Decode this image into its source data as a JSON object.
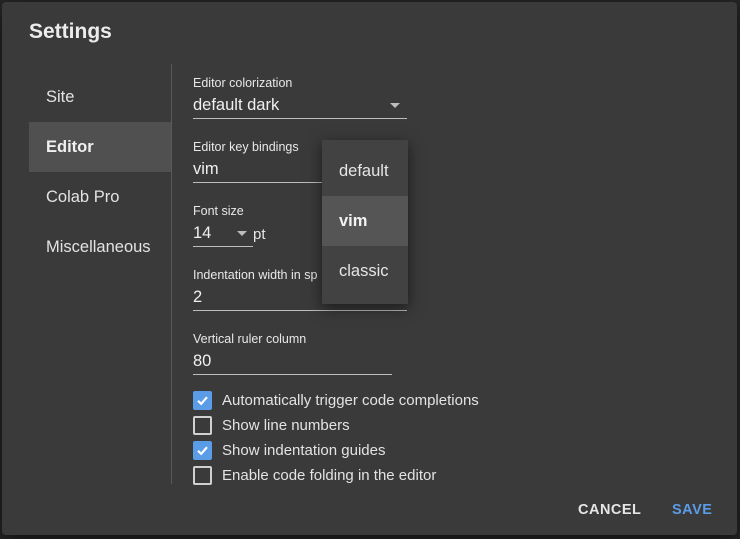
{
  "dialog": {
    "title": "Settings"
  },
  "sidebar": {
    "items": [
      {
        "label": "Site",
        "active": false
      },
      {
        "label": "Editor",
        "active": true
      },
      {
        "label": "Colab Pro",
        "active": false
      },
      {
        "label": "Miscellaneous",
        "active": false
      }
    ]
  },
  "editor": {
    "colorization": {
      "label": "Editor colorization",
      "value": "default dark"
    },
    "key_bindings": {
      "label": "Editor key bindings",
      "value": "vim"
    },
    "font_size": {
      "label": "Font size",
      "value": "14",
      "unit": "pt"
    },
    "indentation": {
      "label": "Indentation width in sp",
      "value": "2"
    },
    "ruler": {
      "label": "Vertical ruler column",
      "value": "80"
    },
    "checkboxes": [
      {
        "label": "Automatically trigger code completions",
        "checked": true
      },
      {
        "label": "Show line numbers",
        "checked": false
      },
      {
        "label": "Show indentation guides",
        "checked": true
      },
      {
        "label": "Enable code folding in the editor",
        "checked": false
      }
    ]
  },
  "key_bindings_menu": {
    "options": [
      "default",
      "vim",
      "classic"
    ],
    "selected": "vim"
  },
  "actions": {
    "cancel_label": "CANCEL",
    "save_label": "SAVE"
  },
  "colors": {
    "accent": "#5b9ce6",
    "dialog_bg": "#3a3a3a",
    "active_nav_bg": "#505050"
  }
}
